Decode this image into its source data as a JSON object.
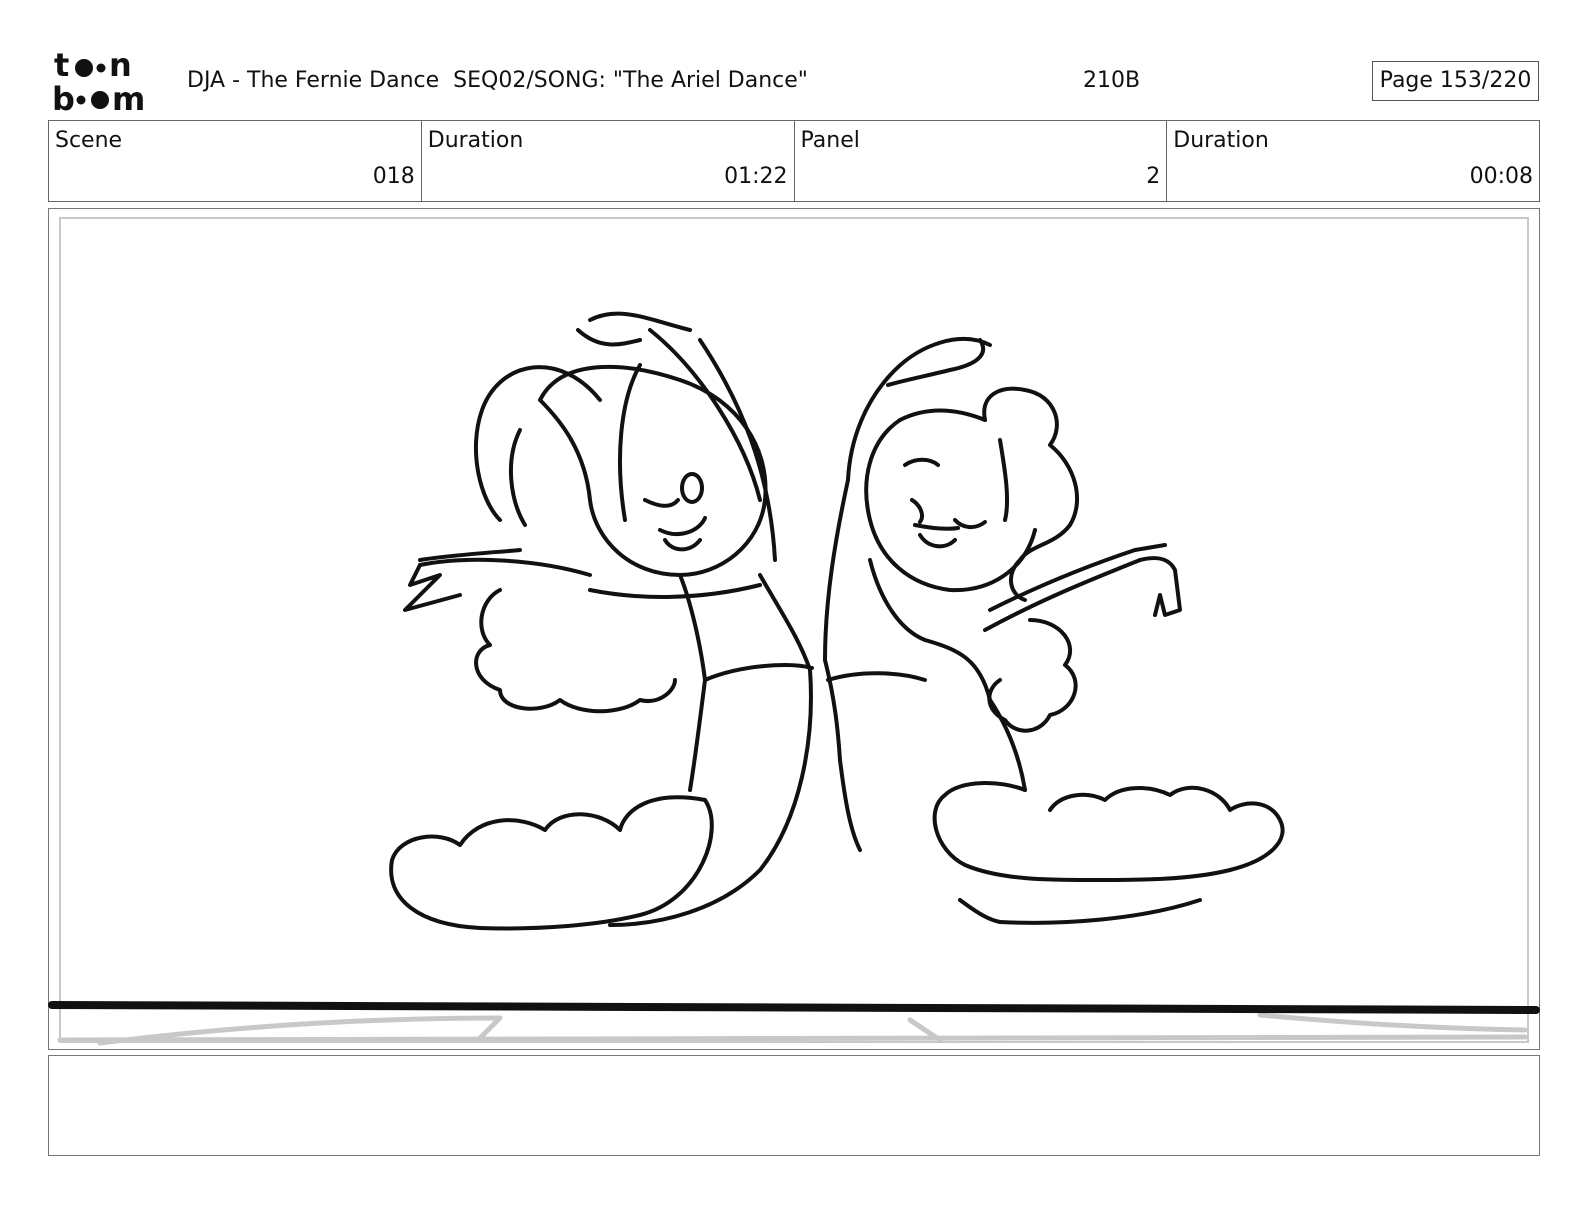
{
  "header": {
    "logo_text": "toonboom",
    "title": "DJA - The Fernie Dance  SEQ02/SONG: \"The Ariel Dance\"",
    "code": "210B",
    "page": "Page 153/220"
  },
  "info": [
    {
      "label": "Scene",
      "value": "018"
    },
    {
      "label": "Duration",
      "value": "01:22"
    },
    {
      "label": "Panel",
      "value": "2"
    },
    {
      "label": "Duration",
      "value": "00:08"
    }
  ],
  "notes": {
    "text": ""
  },
  "colors": {
    "ink": "#111111",
    "frame": "#777777",
    "guide": "#c8c8c8"
  }
}
